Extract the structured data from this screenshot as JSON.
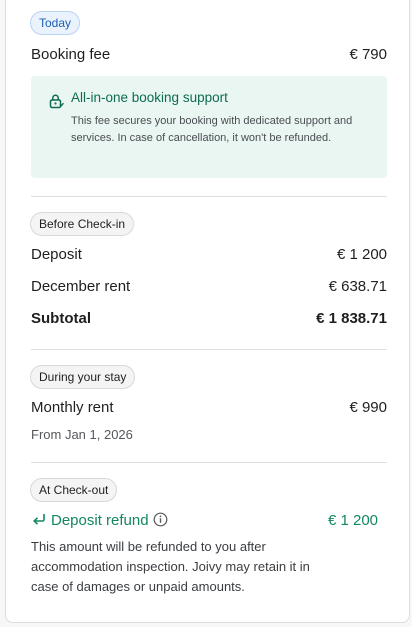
{
  "today": {
    "pill": "Today",
    "booking_fee_label": "Booking fee",
    "booking_fee_value": "€ 790",
    "support": {
      "title": "All-in-one booking support",
      "description": "This fee secures your booking with dedicated support and services. In case of cancellation, it won't be refunded."
    }
  },
  "before_checkin": {
    "pill": "Before Check-in",
    "deposit_label": "Deposit",
    "deposit_value": "€ 1 200",
    "december_rent_label": "December rent",
    "december_rent_value": "€ 638.71",
    "subtotal_label": "Subtotal",
    "subtotal_value": "€ 1 838.71"
  },
  "during_stay": {
    "pill": "During your stay",
    "monthly_rent_label": "Monthly rent",
    "monthly_rent_value": "€ 990",
    "from_date": "From Jan 1, 2026"
  },
  "checkout": {
    "pill": "At Check-out",
    "refund_label": "Deposit refund",
    "refund_value": "€ 1 200",
    "note": "This amount will be refunded to you after accommodation inspection. Joivy may retain it in case of damages or unpaid amounts."
  },
  "icons": {
    "support": "lock-icon",
    "refund": "return-arrow-icon",
    "info": "info-icon"
  },
  "colors": {
    "accent_green": "#13875f",
    "support_bg": "#eaf6f2",
    "today_pill_blue": "#1c5fb3"
  }
}
